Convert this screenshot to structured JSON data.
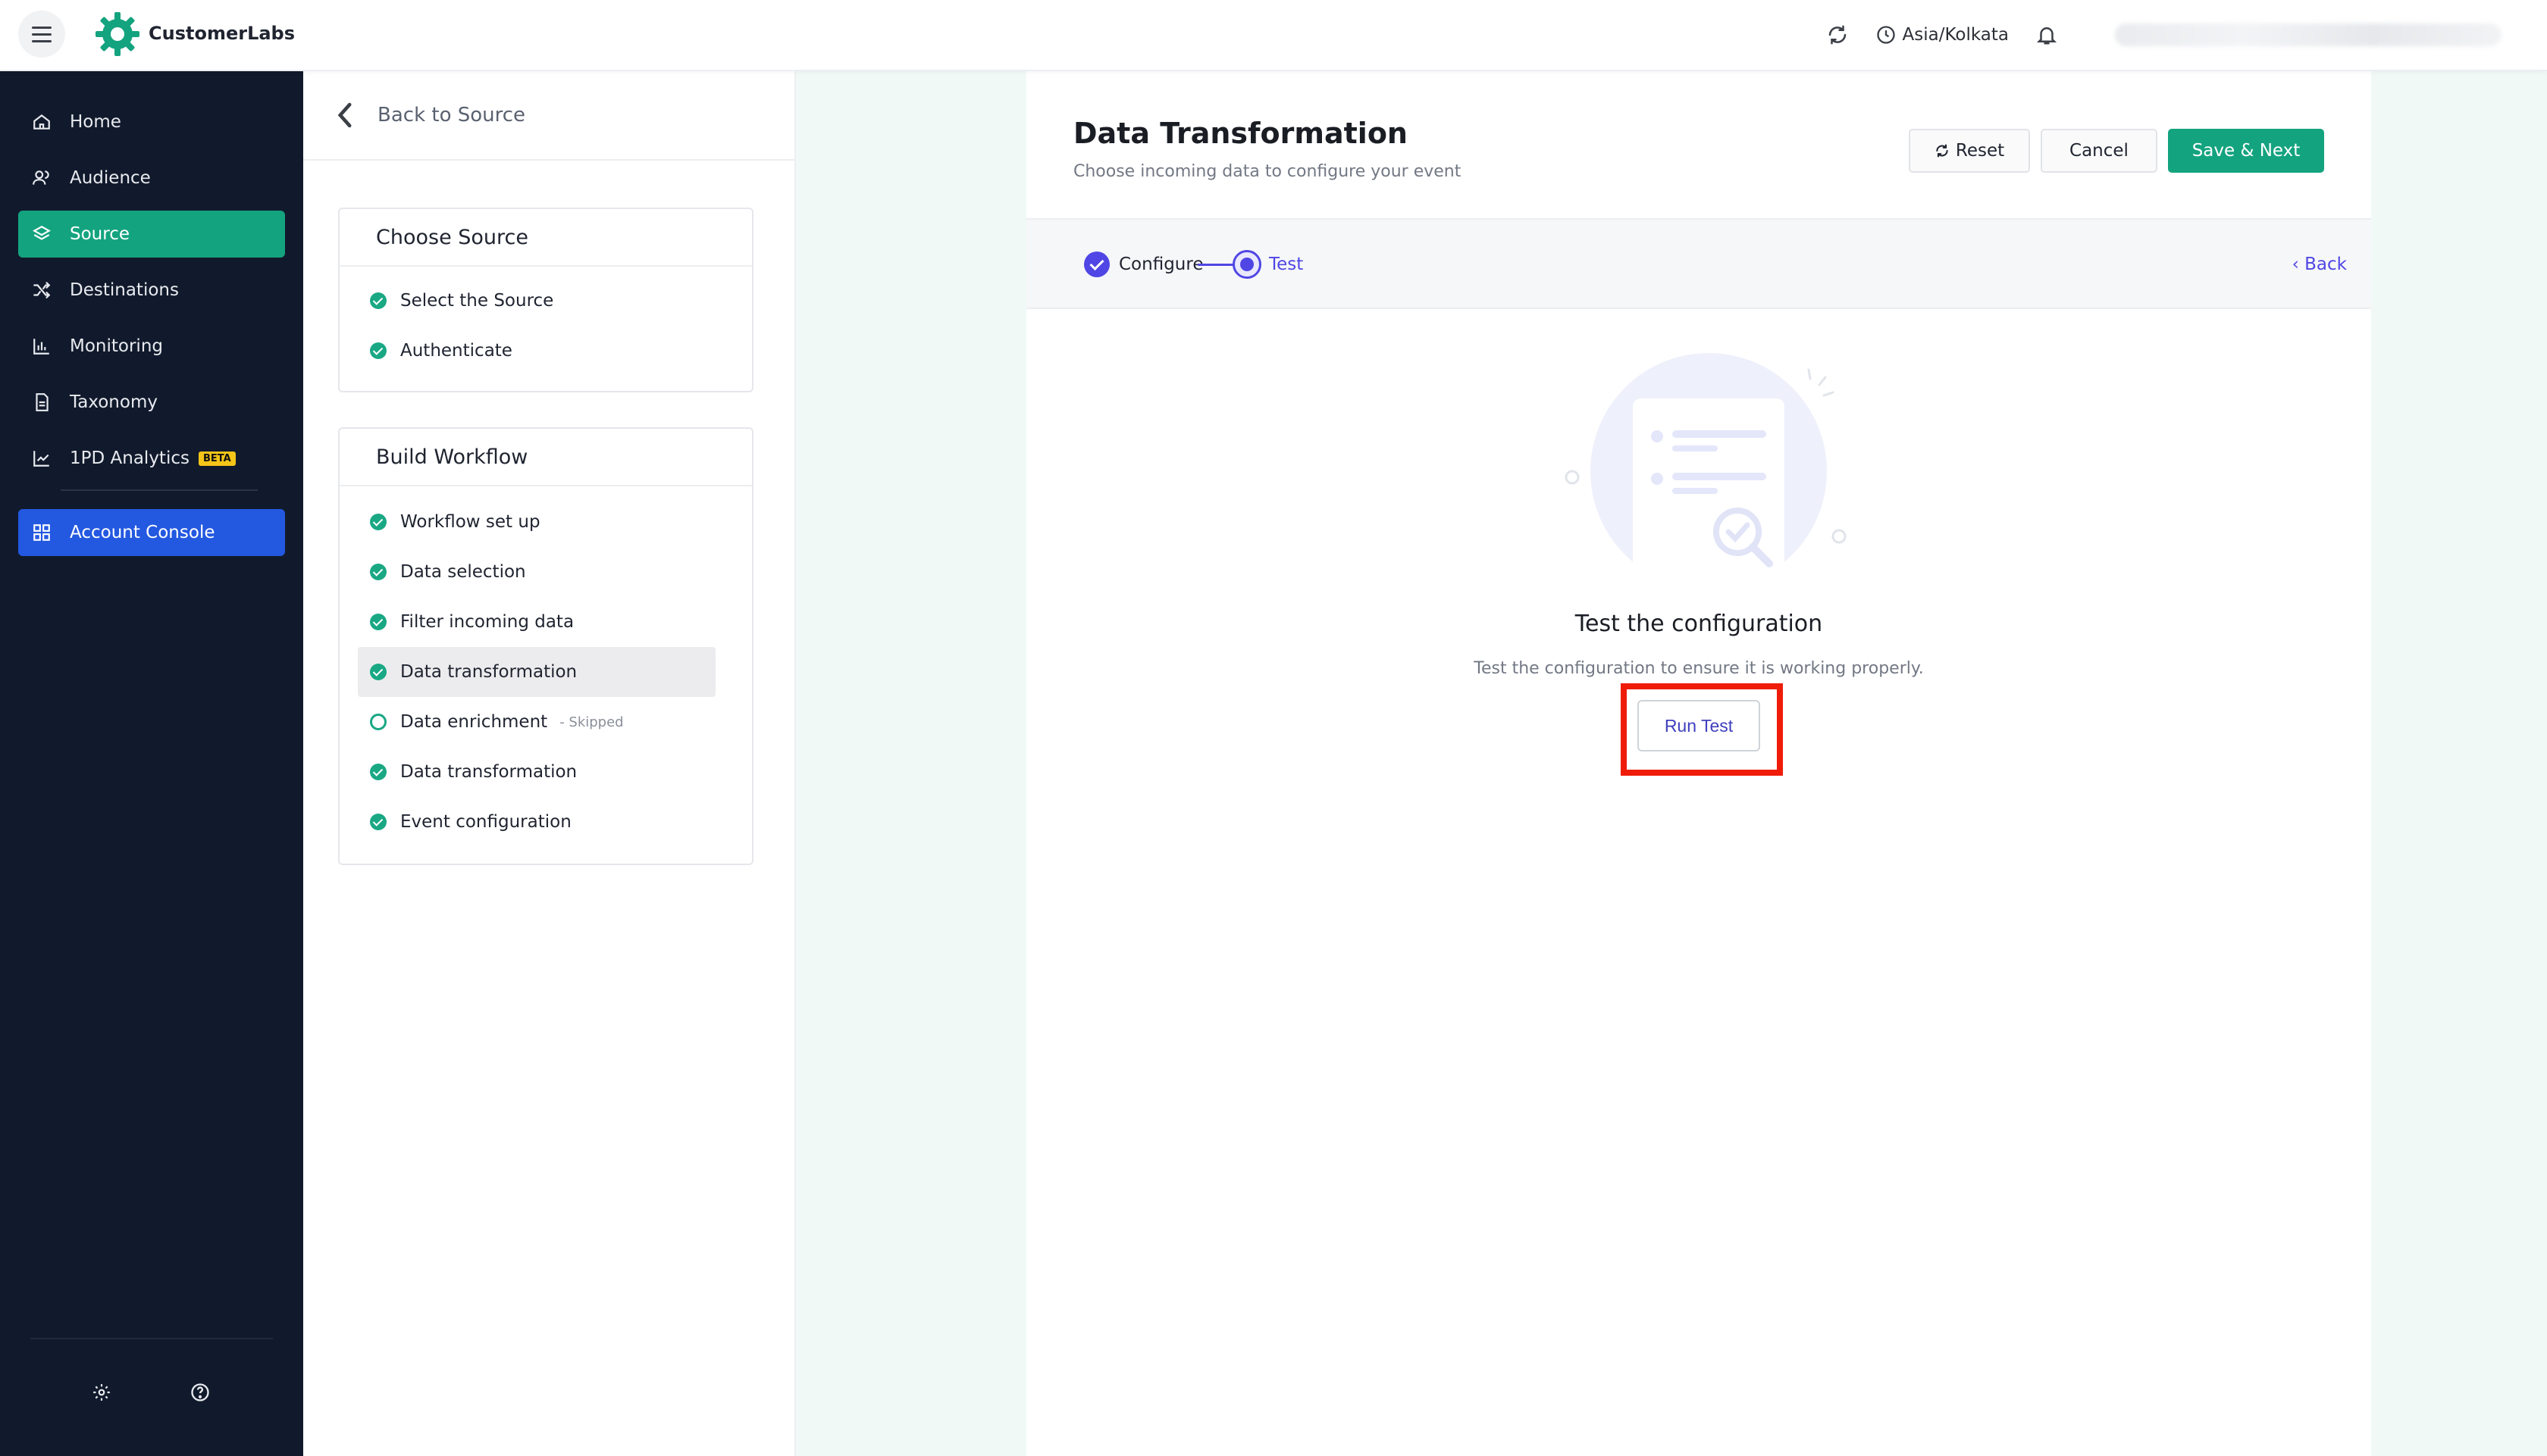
{
  "app": {
    "brand_name": "CustomerLabs",
    "timezone": "Asia/Kolkata"
  },
  "sidebar": {
    "items": [
      {
        "label": "Home",
        "icon": "home-icon"
      },
      {
        "label": "Audience",
        "icon": "users-icon"
      },
      {
        "label": "Source",
        "icon": "layers-icon",
        "active": true
      },
      {
        "label": "Destinations",
        "icon": "shuffle-icon"
      },
      {
        "label": "Monitoring",
        "icon": "chart-icon"
      },
      {
        "label": "Taxonomy",
        "icon": "document-icon"
      },
      {
        "label": "1PD Analytics",
        "icon": "trend-icon",
        "badge": "BETA"
      }
    ],
    "console_label": "Account Console"
  },
  "steps_panel": {
    "back_label": "Back to Source",
    "choose_source": {
      "title": "Choose Source",
      "steps": [
        "Select the Source",
        "Authenticate"
      ]
    },
    "build_workflow": {
      "title": "Build Workflow",
      "steps": [
        {
          "label": "Workflow set up"
        },
        {
          "label": "Data selection"
        },
        {
          "label": "Filter incoming data"
        },
        {
          "label": "Data transformation"
        },
        {
          "label": "Data enrichment",
          "note": "- Skipped"
        },
        {
          "label": "Data transformation"
        },
        {
          "label": "Event configuration"
        }
      ]
    }
  },
  "main": {
    "title": "Data Transformation",
    "subtitle": "Choose incoming data to configure your event",
    "reset_label": "Reset",
    "cancel_label": "Cancel",
    "save_label": "Save & Next",
    "stepper": {
      "step1": "Configure",
      "step2": "Test",
      "back_label": "‹ Back"
    },
    "test": {
      "title": "Test the configuration",
      "description": "Test the configuration to ensure it is working properly.",
      "button_label": "Run Test"
    }
  },
  "colors": {
    "accent_green": "#14a37f",
    "accent_blue": "#2358e0",
    "accent_indigo": "#4f46e5",
    "sidebar_bg": "#111a2c",
    "highlight_red": "#ef1c0a"
  }
}
